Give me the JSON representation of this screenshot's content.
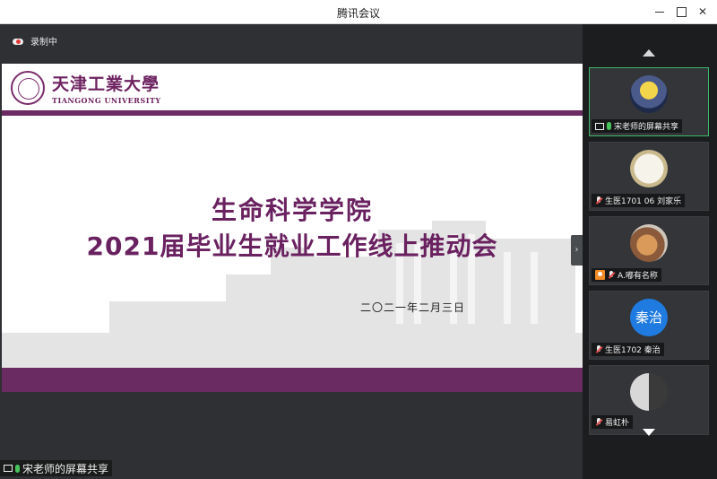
{
  "window": {
    "title": "腾讯会议"
  },
  "recording": {
    "label": "录制中"
  },
  "slide": {
    "university_cn": "天津工業大學",
    "university_en": "TIANGONG UNIVERSITY",
    "title_line1": "生命科学学院",
    "title_line2": "2021届毕业生就业工作线上推动会",
    "date": "二〇二一年二月三日",
    "accent_color": "#6a2a62"
  },
  "share": {
    "label": "宋老师的屏幕共享"
  },
  "participants": [
    {
      "name": "宋老师的屏幕共享",
      "avatar_icon": "minion-avatar",
      "mic": "on",
      "sharing": true,
      "active": true
    },
    {
      "name": "生医1701 06 刘家乐",
      "avatar_icon": "cartoon-avatar",
      "mic": "off",
      "sharing": false,
      "active": false
    },
    {
      "name": "A.嘟有名称",
      "avatar_icon": "pet-photo-avatar",
      "mic": "off",
      "sharing": false,
      "active": false,
      "badge_icon": "person-icon"
    },
    {
      "name": "生医1702 秦治",
      "avatar_text": "秦治",
      "mic": "off",
      "sharing": false,
      "active": false
    },
    {
      "name": "易虹朴",
      "avatar_icon": "bw-photo-avatar",
      "mic": "off",
      "sharing": false,
      "active": false
    }
  ]
}
